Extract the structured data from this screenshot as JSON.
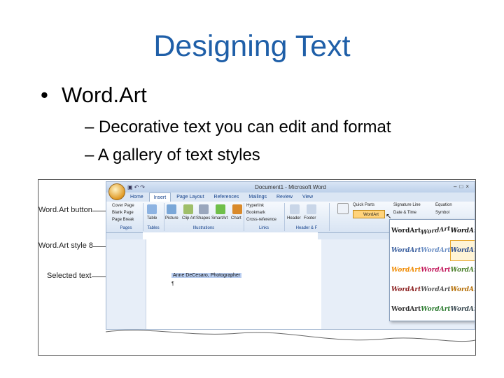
{
  "slide": {
    "title": "Designing Text",
    "bullet1": "Word.Art",
    "sub1": "– Decorative text you can edit and format",
    "sub2": "– A gallery of text styles"
  },
  "callouts": {
    "wordart_button": "Word.Art button",
    "wordart_style": "Word.Art style 8",
    "selected_text": "Selected text"
  },
  "word": {
    "title": "Document1 - Microsoft Word",
    "tabs": [
      "Home",
      "Insert",
      "Page Layout",
      "References",
      "Mailings",
      "Review",
      "View"
    ],
    "active_tab": "Insert",
    "ribbon": {
      "pages": [
        "Cover Page",
        "Blank Page",
        "Page Break"
      ],
      "table": "Table",
      "picture": "Picture",
      "clip_art": "Clip Art",
      "shapes": "Shapes",
      "smartart": "SmartArt",
      "chart": "Chart",
      "hyperlink": "Hyperlink",
      "bookmark": "Bookmark",
      "cross_reference": "Cross-reference",
      "header": "Header",
      "footer": "Footer",
      "text_box": "Text Box",
      "quick_parts": "Quick Parts",
      "wordart": "WordArt",
      "signature_line": "Signature Line",
      "date_time": "Date & Time",
      "equation": "Equation",
      "symbol": "Symbol",
      "groups": [
        "Pages",
        "Tables",
        "Illustrations",
        "Links",
        "Header & F"
      ]
    },
    "document_text": "Anne DeCesaro, Photographer",
    "gallery_items": [
      "WordArt",
      "WordArt",
      "WordArt",
      "WordArt",
      "WordArt",
      "WordArt",
      "WordArt",
      "WordArt",
      "WordArt",
      "WordArt",
      "WordArt",
      "WordArt",
      "WordArt",
      "WordArt",
      "WordArt",
      "WordArt",
      "WordArt",
      "WordArt",
      "WordArt",
      "WordArt",
      "WordArt",
      "WordArt",
      "WordArt",
      "WordArt",
      "WordArt"
    ],
    "gallery_vertical": [
      "W",
      "W",
      "W",
      "W",
      "W"
    ]
  },
  "colors": {
    "title": "#1f5fa8",
    "ribbon": "#dbe6f4",
    "highlight": "#ffd37a"
  }
}
